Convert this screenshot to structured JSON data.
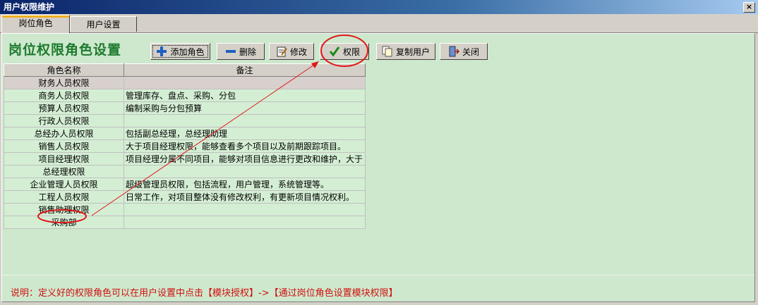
{
  "window": {
    "title": "用户权限维护",
    "close_label": "×"
  },
  "tabs": [
    {
      "label": "岗位角色"
    },
    {
      "label": "用户设置"
    }
  ],
  "header": {
    "title": "岗位权限角色设置"
  },
  "toolbar": {
    "add": "添加角色",
    "delete": "删除",
    "edit": "修改",
    "permission": "权限",
    "copy_user": "复制用户",
    "close": "关闭"
  },
  "table": {
    "columns": [
      "角色名称",
      "备注"
    ],
    "rows": [
      {
        "name": "财务人员权限",
        "note": ""
      },
      {
        "name": "商务人员权限",
        "note": "管理库存、盘点、采购、分包"
      },
      {
        "name": "预算人员权限",
        "note": "编制采购与分包预算"
      },
      {
        "name": "行政人员权限",
        "note": ""
      },
      {
        "name": "总经办人员权限",
        "note": "包括副总经理，总经理助理"
      },
      {
        "name": "销售人员权限",
        "note": "大于项目经理权限，能够查看多个项目以及前期跟踪项目。"
      },
      {
        "name": "项目经理权限",
        "note": "项目经理分属不同项目，能够对项目信息进行更改和维护，大于"
      },
      {
        "name": "总经理权限",
        "note": ""
      },
      {
        "name": "企业管理人员权限",
        "note": "超级管理员权限，包括流程，用户管理，系统管理等。"
      },
      {
        "name": "工程人员权限",
        "note": "日常工作，对项目整体没有修改权利，有更新项目情况权利。"
      },
      {
        "name": "销售助理权限",
        "note": ""
      },
      {
        "name": "采购部",
        "note": ""
      }
    ]
  },
  "footer": {
    "note": "说明：定义好的权限角色可以在用户设置中点击【模块授权】->【通过岗位角色设置模块权限】"
  },
  "colors": {
    "panel_bg": "#cde8cd",
    "title_green": "#1e7a2e",
    "annotation_red": "#e01818"
  }
}
